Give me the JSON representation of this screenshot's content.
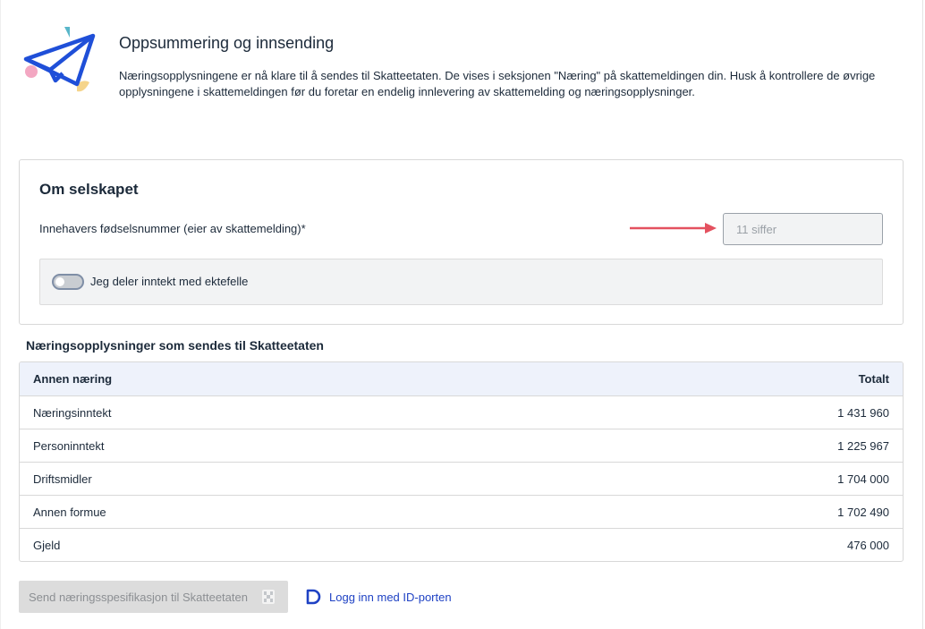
{
  "header": {
    "title": "Oppsummering og innsending",
    "text": "Næringsopplysningene er nå klare til å sendes til Skatteetaten. De vises i seksjonen \"Næring\" på skattemeldingen din. Husk å kontrollere de øvrige opplysningene i skattemeldingen før du foretar en endelig innlevering av skattemelding og næringsopplysninger."
  },
  "company": {
    "title": "Om selskapet",
    "ssn_label": "Innehavers fødselsnummer (eier av skattemelding)*",
    "ssn_value": "",
    "ssn_placeholder": "11 siffer",
    "toggle_label": "Jeg deler inntekt med ektefelle",
    "toggle_on": false
  },
  "summary": {
    "title": "Næringsopplysninger som sendes til Skatteetaten",
    "columns": [
      "Annen næring",
      "Totalt"
    ],
    "rows": [
      {
        "label": "Næringsinntekt",
        "value": "1 431 960"
      },
      {
        "label": "Personinntekt",
        "value": "1 225 967"
      },
      {
        "label": "Driftsmidler",
        "value": "1 704 000"
      },
      {
        "label": "Annen formue",
        "value": "1 702 490"
      },
      {
        "label": "Gjeld",
        "value": "476 000"
      }
    ]
  },
  "actions": {
    "send_label": "Send næringsspesifikasjon til Skatteetaten",
    "send_icon": "send-lock-icon",
    "login_label": "Logg inn med ID-porten",
    "login_icon": "idporten-icon"
  },
  "colors": {
    "accent": "#1f42c4",
    "arrow": "#e4515f",
    "table_header_bg": "#eef2fb"
  }
}
